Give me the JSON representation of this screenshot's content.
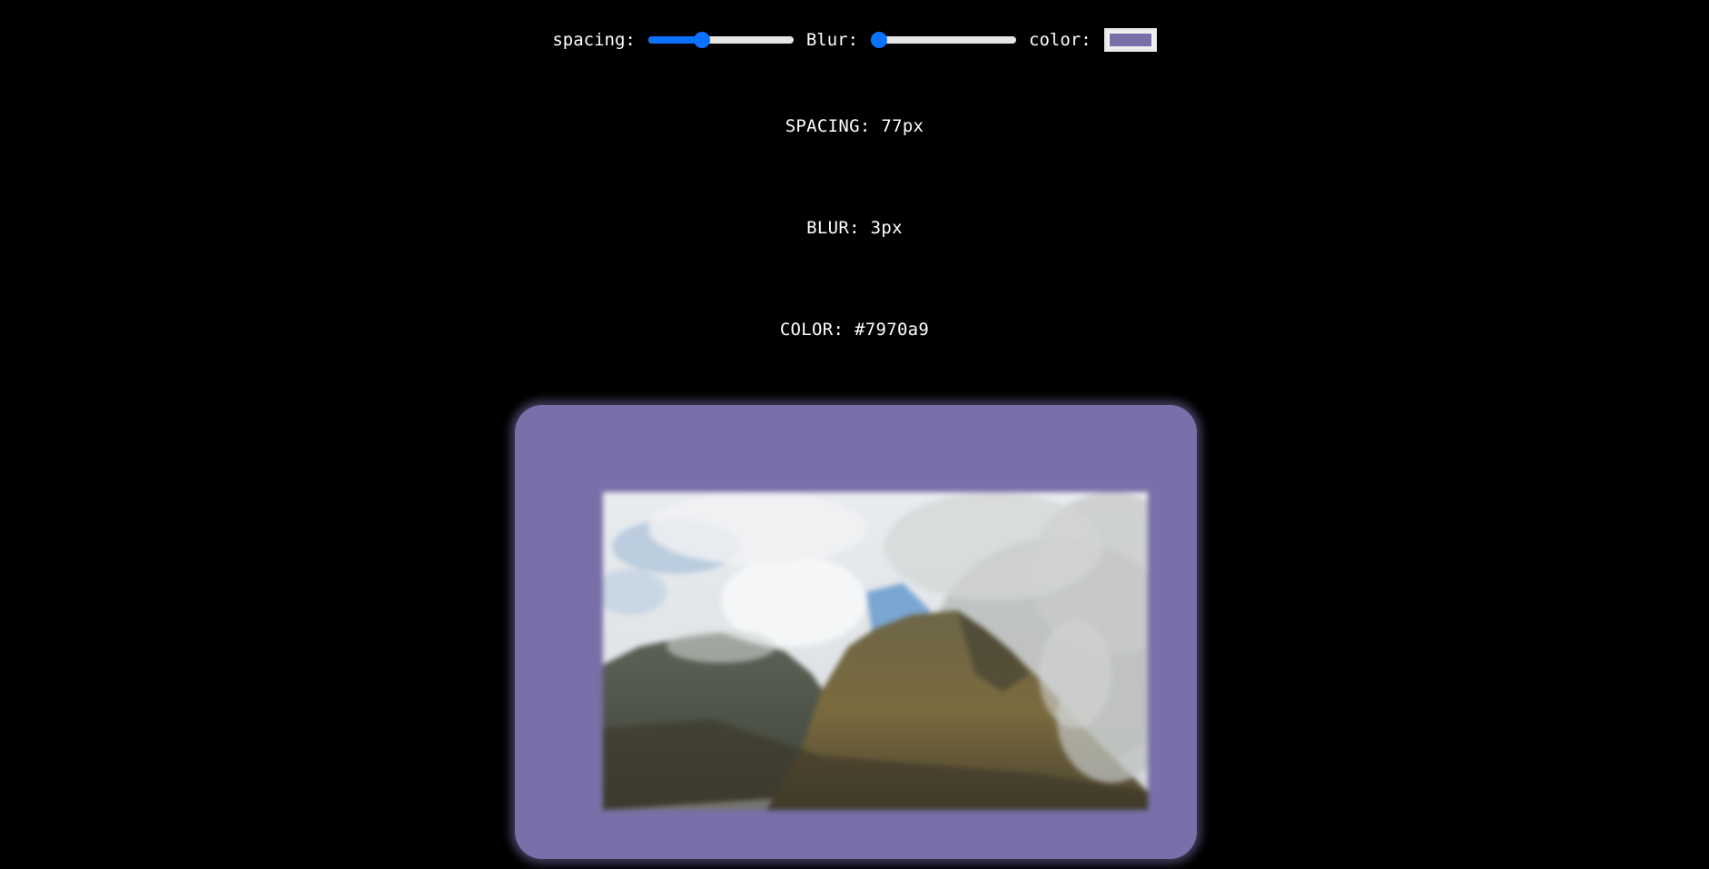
{
  "controls": {
    "spacing_label": "spacing:",
    "blur_label": "Blur:",
    "color_label": "color:",
    "spacing_fraction": 0.37,
    "blur_fraction": 0.04,
    "swatch_color": "#7970a9",
    "slider_accent": "#0a72ff"
  },
  "readouts": {
    "spacing": "SPACING: 77px",
    "blur": "BLUR: 3px",
    "color": "COLOR: #7970a9"
  },
  "frame": {
    "color": "#7970a9"
  },
  "image": {
    "subject": "mountain-ridge-with-clouds"
  }
}
